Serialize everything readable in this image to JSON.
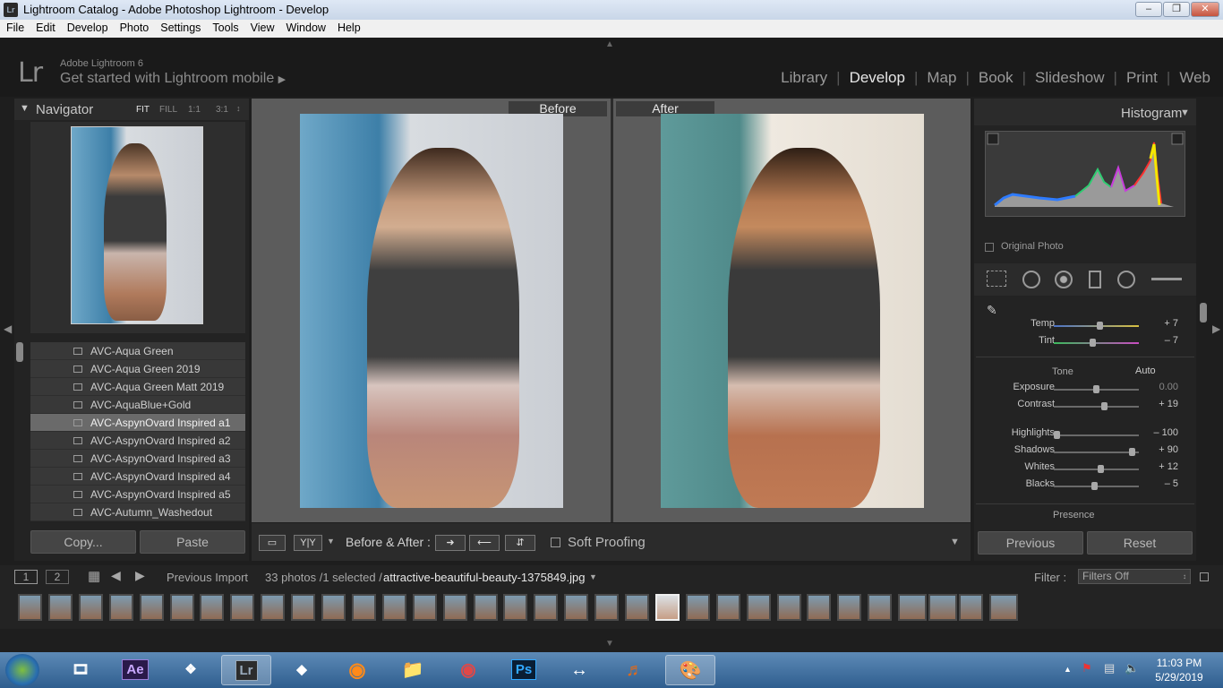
{
  "window": {
    "app_icon": "Lr",
    "title": "Lightroom Catalog - Adobe Photoshop Lightroom - Develop"
  },
  "menu": [
    "File",
    "Edit",
    "Develop",
    "Photo",
    "Settings",
    "Tools",
    "View",
    "Window",
    "Help"
  ],
  "identity": {
    "logo": "Lr",
    "product": "Adobe Lightroom 6",
    "mobile": "Get started with Lightroom mobile"
  },
  "modules": [
    "Library",
    "Develop",
    "Map",
    "Book",
    "Slideshow",
    "Print",
    "Web"
  ],
  "active_module": "Develop",
  "navigator": {
    "title": "Navigator",
    "zoom": [
      "FIT",
      "FILL",
      "1:1",
      "3:1"
    ]
  },
  "presets": [
    {
      "name": "AVC-Aqua Green"
    },
    {
      "name": "AVC-Aqua Green 2019"
    },
    {
      "name": "AVC-Aqua Green Matt 2019"
    },
    {
      "name": "AVC-AquaBlue+Gold"
    },
    {
      "name": "AVC-AspynOvard Inspired a1",
      "selected": true
    },
    {
      "name": "AVC-AspynOvard Inspired a2"
    },
    {
      "name": "AVC-AspynOvard Inspired a3"
    },
    {
      "name": "AVC-AspynOvard Inspired a4"
    },
    {
      "name": "AVC-AspynOvard Inspired a5"
    },
    {
      "name": "AVC-Autumn_Washedout"
    }
  ],
  "left_buttons": {
    "copy": "Copy...",
    "paste": "Paste"
  },
  "compare": {
    "before_label": "Before",
    "after_label": "After"
  },
  "toolbar": {
    "before_after_label": "Before & After :",
    "soft_proofing": "Soft Proofing",
    "yy": "Y|Y"
  },
  "right": {
    "histogram_title": "Histogram",
    "original_photo": "Original Photo",
    "wb": [
      {
        "label": "Temp",
        "value": "+ 7",
        "pos": 0.55
      },
      {
        "label": "Tint",
        "value": "– 7",
        "pos": 0.45
      }
    ],
    "tone_label": "Tone",
    "auto_label": "Auto",
    "tone": [
      {
        "label": "Exposure",
        "value": "0.00",
        "pos": 0.5
      },
      {
        "label": "Contrast",
        "value": "+ 19",
        "pos": 0.6
      }
    ],
    "tone2": [
      {
        "label": "Highlights",
        "value": "– 100",
        "pos": 0.0
      },
      {
        "label": "Shadows",
        "value": "+ 90",
        "pos": 0.95
      },
      {
        "label": "Whites",
        "value": "+ 12",
        "pos": 0.56
      },
      {
        "label": "Blacks",
        "value": "– 5",
        "pos": 0.48
      }
    ],
    "presence_label": "Presence",
    "previous": "Previous",
    "reset": "Reset"
  },
  "filmbar": {
    "screen1": "1",
    "screen2": "2",
    "source": "Previous Import",
    "count": "33 photos /1 selected /",
    "filename": "attractive-beautiful-beauty-1375849.jpg",
    "filter_label": "Filter :",
    "filter_value": "Filters Off"
  },
  "film_thumbs": 33,
  "selected_thumb": 21,
  "taskbar": {
    "apps": [
      "start",
      "movie-maker",
      "Ae",
      "pinned-app",
      "Lr",
      "Filmora",
      "Firefox",
      "Explorer",
      "Recorder",
      "Ps",
      "TeamViewer",
      "Audio",
      "Paint"
    ],
    "time": "11:03 PM",
    "date": "5/29/2019"
  }
}
